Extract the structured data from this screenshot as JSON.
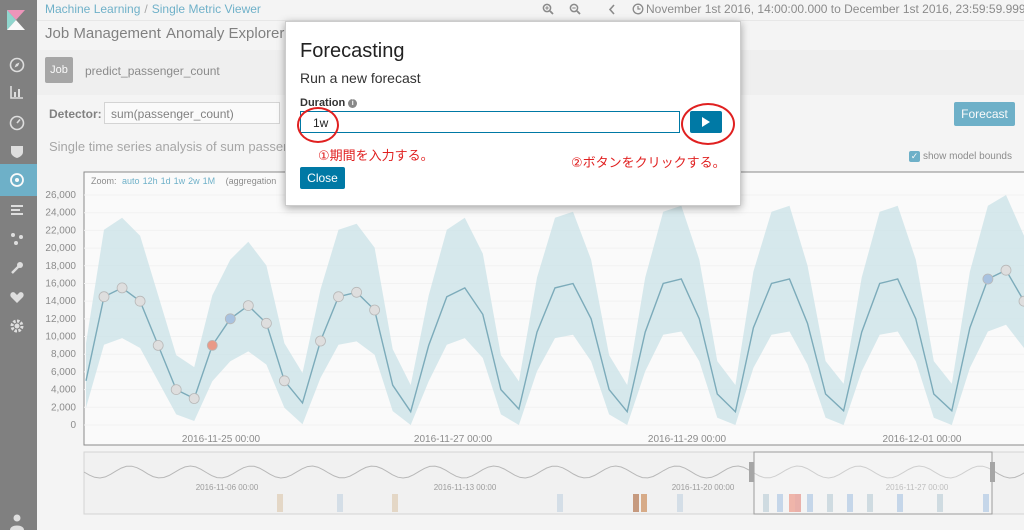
{
  "breadcrumb": {
    "root": "Machine Learning",
    "sep": "/",
    "current": "Single Metric Viewer"
  },
  "time_range": "November 1st 2016, 14:00:00.000 to December 1st 2016, 23:59:59.999",
  "icons": {
    "zoom_in": "zoom-in-icon",
    "zoom_out": "zoom-out-icon",
    "prev": "chevron-left-icon",
    "clock": "clock-icon"
  },
  "ml_tabs": [
    "Job Management",
    "Anomaly Explorer"
  ],
  "job": {
    "tag": "Job",
    "name": "predict_passenger_count"
  },
  "detector": {
    "label": "Detector:",
    "value": "sum(passenger_count)"
  },
  "forecast_button": "Forecast",
  "subtitle": "Single time series analysis of sum passen",
  "show_model_bounds": "show model bounds",
  "zoom": {
    "label": "Zoom:",
    "options": [
      "auto",
      "12h",
      "1d",
      "1w",
      "2w",
      "1M"
    ],
    "aggregation": "(aggregation"
  },
  "chart_data": {
    "type": "line",
    "y_ticks": [
      "26,000",
      "24,000",
      "22,000",
      "20,000",
      "18,000",
      "16,000",
      "14,000",
      "12,000",
      "10,000",
      "8,000",
      "6,000",
      "4,000",
      "2,000",
      "0"
    ],
    "x_ticks": [
      "2016-11-25 00:00",
      "2016-11-27 00:00",
      "2016-11-29 00:00",
      "2016-12-01 00:00"
    ],
    "ylim": [
      0,
      26000
    ],
    "series": [
      {
        "values": [
          5000,
          14500,
          15500,
          14000,
          9000,
          4000,
          3000,
          9000,
          12000,
          13500,
          11500,
          5000,
          2500,
          9500,
          14500,
          15000,
          13000,
          4500,
          1500,
          9000,
          14500,
          15500,
          12500,
          4000,
          1800,
          10500,
          15500,
          16000,
          12000,
          4000,
          1500,
          10500,
          16000,
          16500,
          12000,
          3500,
          1500,
          11000,
          16000,
          16500,
          11500,
          3500,
          1600,
          10500,
          16000,
          16500,
          12000,
          3500,
          1600,
          11000,
          16500,
          17500,
          14000
        ]
      }
    ],
    "context_ticks": [
      "2016-11-06 00:00",
      "2016-11-13 00:00",
      "2016-11-20 00:00",
      "2016-11-27 00:00"
    ]
  },
  "modal": {
    "title": "Forecasting",
    "subtitle": "Run a new forecast",
    "duration_label": "Duration",
    "info_icon": "i",
    "duration_value": "1w",
    "close": "Close"
  },
  "annotations": {
    "step1": "①期間を入力する。",
    "step2": "②ボタンをクリックする。"
  },
  "colors": {
    "accent": "#0079a5",
    "annotation": "#e02020",
    "band": "#a8d4de",
    "line": "#1a6f8a"
  }
}
